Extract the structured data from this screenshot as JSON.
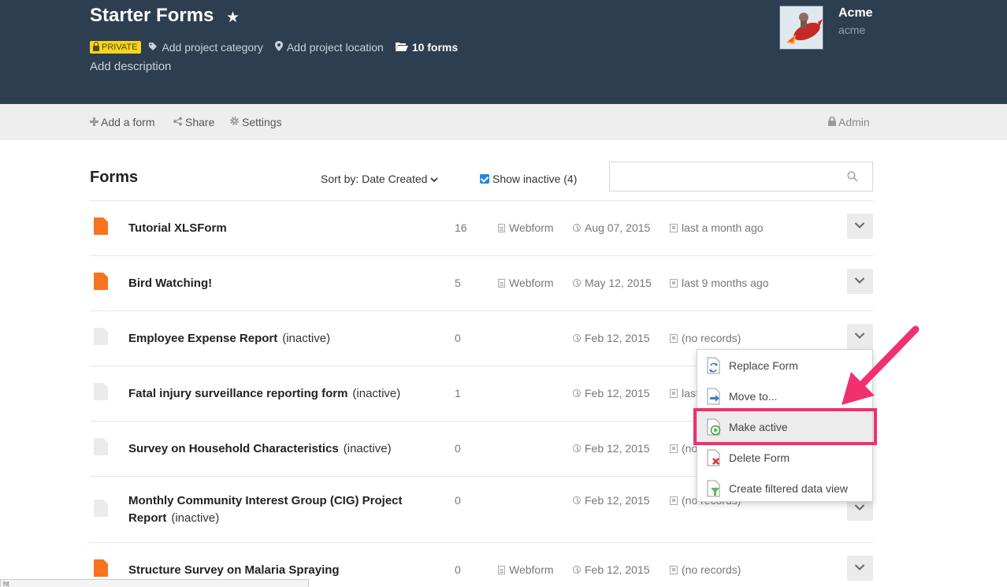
{
  "header": {
    "title": "Starter Forms",
    "private_badge": "PRIVATE",
    "category_link": "Add project category",
    "location_link": "Add project location",
    "forms_count": "10 forms",
    "description_link": "Add description",
    "org_name": "Acme",
    "org_handle": "acme",
    "background_color": "#2d3e50"
  },
  "toolbar": {
    "add_form": "Add a form",
    "share": "Share",
    "settings": "Settings",
    "admin": "Admin"
  },
  "forms_section": {
    "title": "Forms",
    "sort_label": "Sort by: Date Created",
    "show_inactive_label": "Show inactive (4)",
    "show_inactive_checked": true,
    "search_placeholder": ""
  },
  "forms": [
    {
      "name": "Tutorial XLSForm",
      "status": "",
      "count": "16",
      "type": "Webform",
      "date": "Aug 07, 2015",
      "last": "last a month ago",
      "active": true
    },
    {
      "name": "Bird Watching!",
      "status": "",
      "count": "5",
      "type": "Webform",
      "date": "May 12, 2015",
      "last": "last 9 months ago",
      "active": true
    },
    {
      "name": "Employee Expense Report",
      "status": "(inactive)",
      "count": "0",
      "type": "",
      "date": "Feb 12, 2015",
      "last": "(no records)",
      "active": false
    },
    {
      "name": "Fatal injury surveillance reporting form",
      "status": "(inactive)",
      "count": "1",
      "type": "",
      "date": "Feb 12, 2015",
      "last": "last",
      "active": false
    },
    {
      "name": "Survey on Household Characteristics",
      "status": "(inactive)",
      "count": "0",
      "type": "",
      "date": "Feb 12, 2015",
      "last": "(no",
      "active": false
    },
    {
      "name": "Monthly Community Interest Group (CIG) Project Report",
      "status": "(inactive)",
      "count": "0",
      "type": "",
      "date": "Feb 12, 2015",
      "last": "(no records)",
      "active": false
    },
    {
      "name": "Structure Survey on Malaria Spraying",
      "status": "",
      "count": "0",
      "type": "Webform",
      "date": "Feb 12, 2015",
      "last": "(no records)",
      "active": true
    }
  ],
  "dropdown_menu": {
    "items": [
      {
        "label": "Replace Form",
        "icon": "replace-form-icon"
      },
      {
        "label": "Move to...",
        "icon": "move-to-icon"
      },
      {
        "label": "Make active",
        "icon": "make-active-icon",
        "highlighted": true
      },
      {
        "label": "Delete Form",
        "icon": "delete-form-icon"
      },
      {
        "label": "Create filtered data view",
        "icon": "filter-view-icon"
      }
    ]
  },
  "annotation": {
    "highlight_color": "#f0306f"
  },
  "status_bar": {
    "text": "ht"
  }
}
